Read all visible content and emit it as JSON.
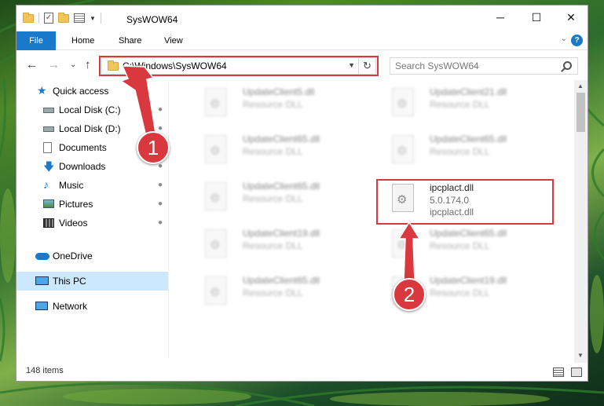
{
  "window": {
    "title": "SysWOW64",
    "controls": {
      "minimize": "─",
      "maximize": "☐",
      "close": "✕"
    }
  },
  "ribbon": {
    "tabs": [
      "File",
      "Home",
      "Share",
      "View"
    ],
    "expand": "⌄",
    "help": "?"
  },
  "nav": {
    "back": "←",
    "forward": "→",
    "recent": "⌄",
    "up": "↑",
    "address": "C:\\Windows\\SysWOW64",
    "refresh": "↻",
    "search_placeholder": "Search SysWOW64"
  },
  "sidebar": {
    "items": [
      {
        "label": "Quick access",
        "icon": "star-icon",
        "pinned": false
      },
      {
        "label": "Local Disk (C:)",
        "icon": "drive-icon",
        "pinned": true
      },
      {
        "label": "Local Disk (D:)",
        "icon": "drive-icon",
        "pinned": true
      },
      {
        "label": "Documents",
        "icon": "documents-icon",
        "pinned": true
      },
      {
        "label": "Downloads",
        "icon": "download-icon",
        "pinned": true
      },
      {
        "label": "Music",
        "icon": "music-icon",
        "pinned": true
      },
      {
        "label": "Pictures",
        "icon": "pictures-icon",
        "pinned": true
      },
      {
        "label": "Videos",
        "icon": "videos-icon",
        "pinned": true
      },
      {
        "label": "OneDrive",
        "icon": "cloud-icon",
        "pinned": false
      },
      {
        "label": "This PC",
        "icon": "computer-icon",
        "pinned": false,
        "selected": true
      },
      {
        "label": "Network",
        "icon": "network-icon",
        "pinned": false
      }
    ],
    "pin_glyph": "📌"
  },
  "files": [
    {
      "name": "UpdateClient5.dll",
      "line1": "Resource DLL",
      "line2": "",
      "blurred": true
    },
    {
      "name": "UpdateClient21.dll",
      "line1": "Resource DLL",
      "line2": "",
      "blurred": true
    },
    {
      "name": "UpdateClient65.dll",
      "line1": "Resource DLL",
      "line2": "",
      "blurred": true
    },
    {
      "name": "UpdateClient65.dll",
      "line1": "Resource DLL",
      "line2": "",
      "blurred": true
    },
    {
      "name": "UpdateClient65.dll",
      "line1": "Resource DLL",
      "line2": "",
      "blurred": true
    },
    {
      "name": "ipcplact.dll",
      "line1": "5.0.174.0",
      "line2": "ipcplact.dll",
      "blurred": false,
      "highlighted": true
    },
    {
      "name": "UpdateClient19.dll",
      "line1": "Resource DLL",
      "line2": "",
      "blurred": true
    },
    {
      "name": "UpdateClient65.dll",
      "line1": "Resource DLL",
      "line2": "",
      "blurred": true
    },
    {
      "name": "UpdateClient65.dll",
      "line1": "Resource DLL",
      "line2": "",
      "blurred": true
    },
    {
      "name": "UpdateClient19.dll",
      "line1": "Resource DLL",
      "line2": "",
      "blurred": true
    }
  ],
  "status": {
    "item_count": "148 items"
  },
  "annotations": {
    "badge1": "1",
    "badge2": "2"
  },
  "colors": {
    "accent": "#1979ca",
    "highlight_red": "#d9393e",
    "selected_bg": "#cce8ff"
  }
}
